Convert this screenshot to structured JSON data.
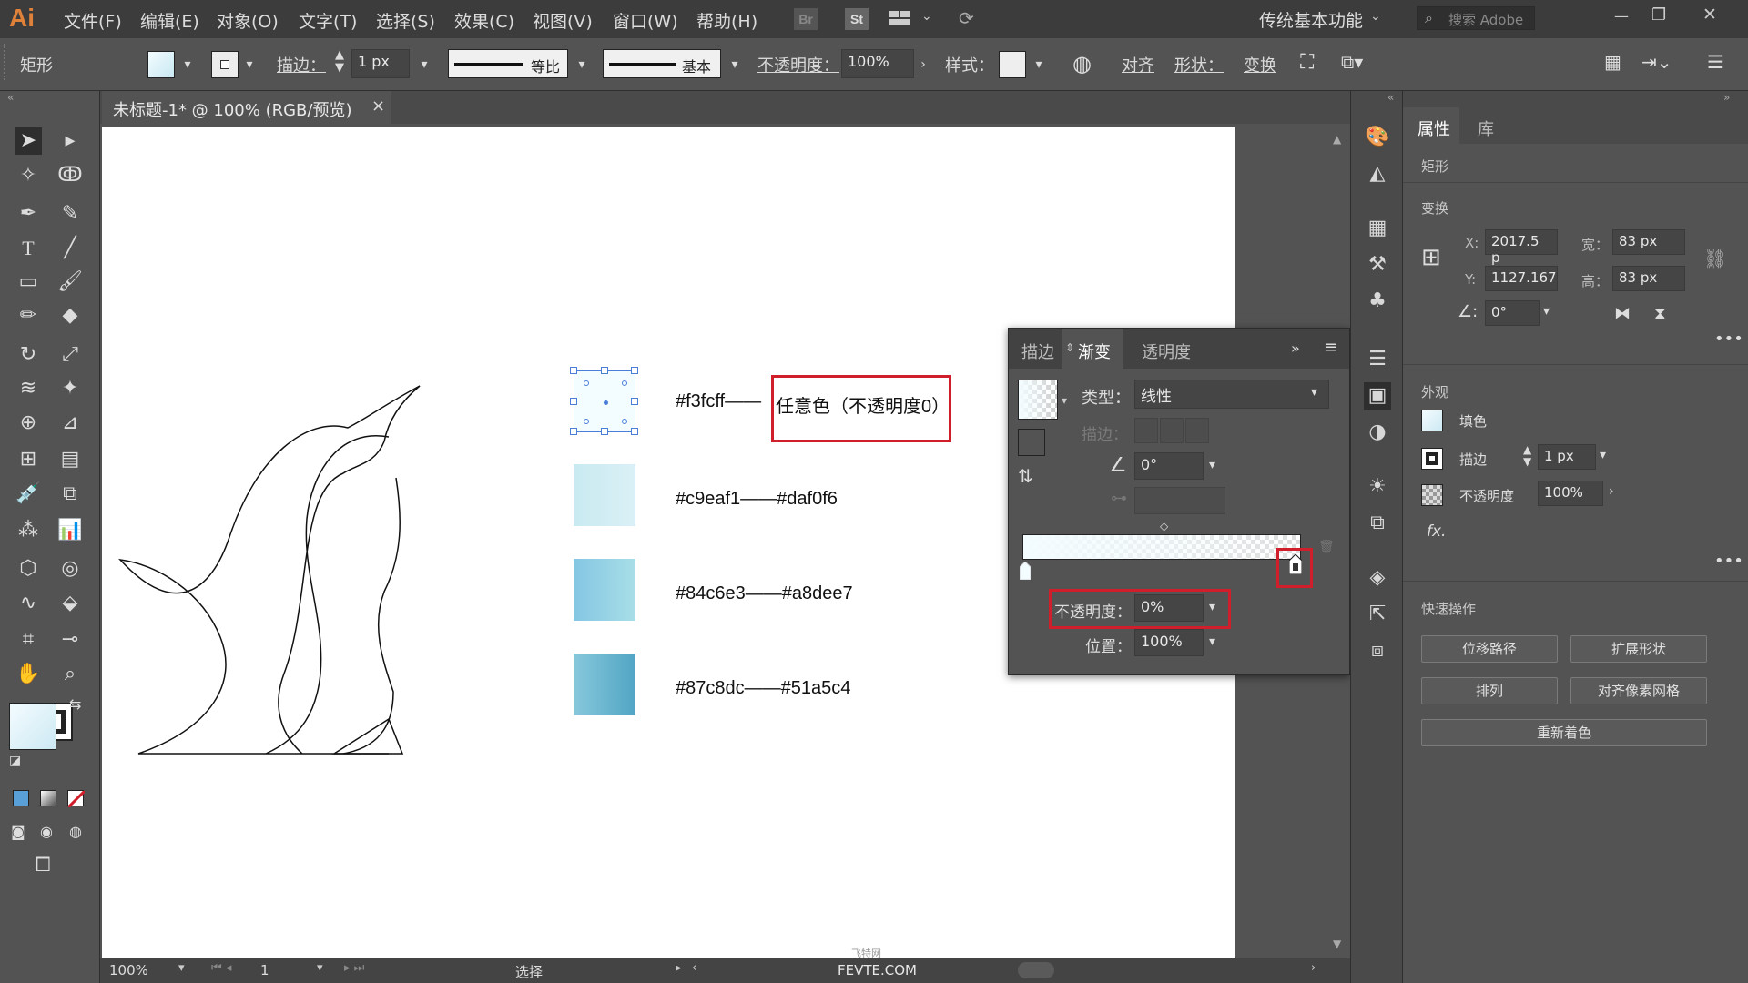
{
  "app": {
    "logo": "Ai",
    "menus": [
      "文件(F)",
      "编辑(E)",
      "对象(O)",
      "文字(T)",
      "选择(S)",
      "效果(C)",
      "视图(V)",
      "窗口(W)",
      "帮助(H)"
    ],
    "bridge": "Br",
    "stock": "St",
    "workspace": "传统基本功能",
    "search_placeholder": "搜索 Adobe",
    "win_minimize": "—",
    "win_restore": "❐",
    "win_close": "✕"
  },
  "control_bar": {
    "object_type": "矩形",
    "stroke_label": "描边：",
    "stroke_weight": "1 px",
    "profile_label": "等比",
    "brush_label": "基本",
    "opacity_label": "不透明度：",
    "opacity_value": "100%",
    "style_label": "样式：",
    "align_label": "对齐",
    "shape_label": "形状：",
    "transform_label": "变换"
  },
  "document": {
    "tab_title": "未标题-1* @ 100% (RGB/预览)",
    "tab_close": "×"
  },
  "canvas": {
    "swatches": [
      {
        "label": "#f3fcff——",
        "from": "#f3fcff",
        "to": "#e2f4fa"
      },
      {
        "label": "#c9eaf1——#daf0f6",
        "from": "#c9eaf1",
        "to": "#daf0f6"
      },
      {
        "label": "#84c6e3——#a8dee7",
        "from": "#84c6e3",
        "to": "#a8dee7"
      },
      {
        "label": "#87c8dc——#51a5c4",
        "from": "#87c8dc",
        "to": "#51a5c4"
      }
    ],
    "annotation": "任意色（不透明度0）",
    "accent_red": "#d01f2a"
  },
  "gradient_panel": {
    "tabs": [
      "描边",
      "渐变",
      "透明度"
    ],
    "type_label": "类型：",
    "type_value": "线性",
    "stroke_label": "描边：",
    "angle_label": "∠",
    "angle_value": "0°",
    "opacity_label": "不透明度：",
    "opacity_value": "0%",
    "location_label": "位置：",
    "location_value": "100%"
  },
  "properties": {
    "tabs": [
      "属性",
      "库"
    ],
    "object_type": "矩形",
    "transform_title": "变换",
    "x_label": "X:",
    "x_value": "2017.5 p",
    "y_label": "Y:",
    "y_value": "1127.167",
    "w_label": "宽：",
    "w_value": "83 px",
    "h_label": "高：",
    "h_value": "83 px",
    "angle_value": "0°",
    "appearance_title": "外观",
    "fill_label": "填色",
    "stroke_label": "描边",
    "stroke_value": "1 px",
    "opacity_label": "不透明度",
    "opacity_value": "100%",
    "fx_label": "fx.",
    "quick_title": "快速操作",
    "buttons": [
      "位移路径",
      "扩展形状",
      "排列",
      "对齐像素网格",
      "重新着色"
    ]
  },
  "status_bar": {
    "zoom": "100%",
    "page": "1",
    "tool": "选择",
    "watermark": "FEVTE.COM",
    "watermark_small": "飞特网"
  }
}
